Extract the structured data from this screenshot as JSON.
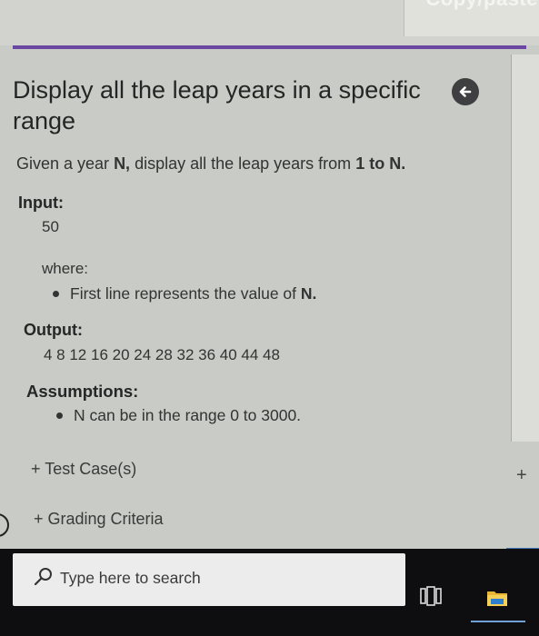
{
  "header": {
    "copy_label": "Copy/paste"
  },
  "problem": {
    "title": "Display all the leap years in a specific range",
    "description": {
      "part1": "Given a year ",
      "var": "N,",
      "part2": " display all the leap years from ",
      "range": "1 to N."
    },
    "input_label": "Input:",
    "input_value": "50",
    "where_label": "where:",
    "input_bullet": {
      "text": "First line represents the value of ",
      "var": "N."
    },
    "output_label": "Output:",
    "output_value": "4 8 12 16 20 24 28 32 36 40 44 48",
    "assumptions_label": "Assumptions:",
    "assumption_bullet": "N can be in the range 0 to 3000."
  },
  "links": {
    "test_cases": "+ Test Case(s)",
    "grading": "+ Grading Criteria",
    "right_plus": "+"
  },
  "taskbar": {
    "search_placeholder": "Type here to search",
    "accent": "#6b47a3"
  }
}
